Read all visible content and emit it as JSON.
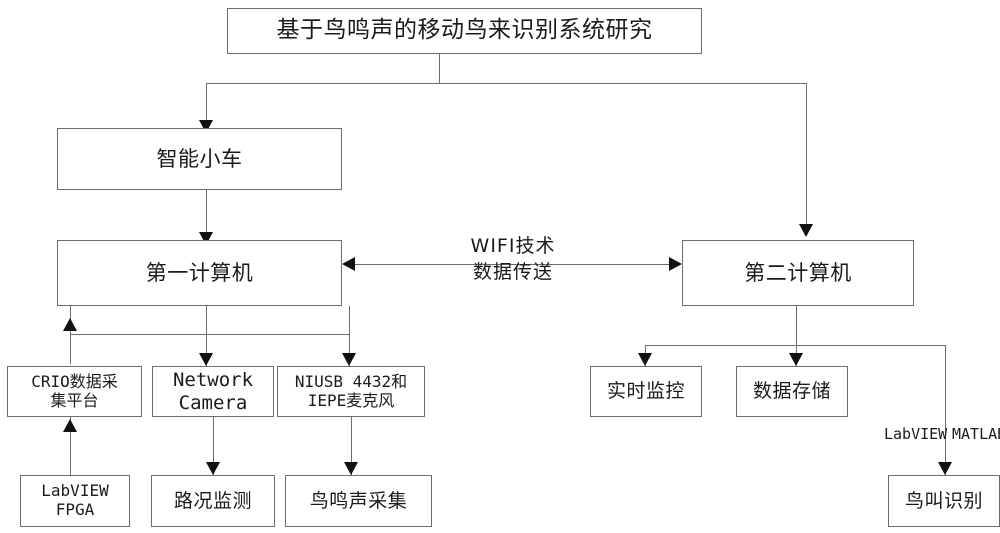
{
  "diagram": {
    "title_node": {
      "label": "基于鸟鸣声的移动鸟来识别系统研究"
    },
    "nodes": {
      "smart_car": {
        "label": "智能小车"
      },
      "computer_first": {
        "label": "第一计算机"
      },
      "computer_second": {
        "label": "第二计算机"
      },
      "crio_platform": {
        "label": "CRIO数据采\n集平台"
      },
      "network_camera": {
        "label": "Network\nCamera"
      },
      "niusb_mic": {
        "label": "NIUSB 4432和\nIEPE麦克风"
      },
      "labview_fpga": {
        "label": "LabVIEW\nFPGA"
      },
      "road_monitor": {
        "label": "路况监测"
      },
      "bird_sound_collect": {
        "label": "鸟鸣声采集"
      },
      "realtime_monitor": {
        "label": "实时监控"
      },
      "data_storage": {
        "label": "数据存储"
      },
      "bird_call_recognition": {
        "label": "鸟叫识别"
      }
    },
    "edge_labels": {
      "wifi_link": "WIFI技术\n数据传送",
      "labview_tag": "LabVIEW",
      "matlab_tag": "MATLAB"
    },
    "colors": {
      "box_border": "#6d6d6d",
      "connector": "#6d6d6d",
      "arrow_head": "#111111",
      "text": "#1b1b1b",
      "background": "#ffffff"
    }
  }
}
